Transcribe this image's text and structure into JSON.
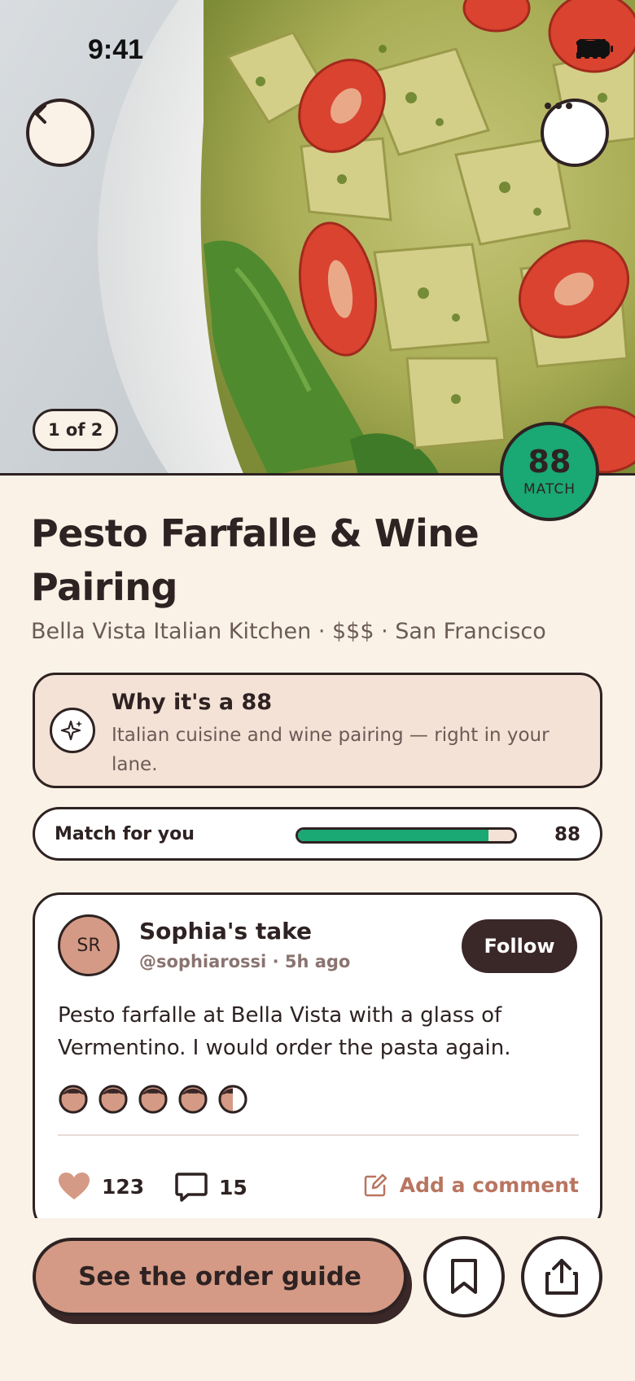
{
  "status_bar": {
    "time": "9:41"
  },
  "hero": {
    "photo_counter": "1 of 2",
    "match_score": "88",
    "match_label": "MATCH"
  },
  "dish": {
    "title": "Pesto Farfalle & Wine Pairing",
    "subtitle": "Bella Vista Italian Kitchen · $$$ · San Francisco"
  },
  "why": {
    "title": "Why it's a 88",
    "text": "Italian cuisine and wine pairing — right in your lane."
  },
  "match_row": {
    "label": "Match for you",
    "value": "88",
    "fraction": 0.88
  },
  "review": {
    "avatar_initials": "SR",
    "name": "Sophia's take",
    "meta": "@sophiarossi · 5h ago",
    "follow_label": "Follow",
    "text": "Pesto farfalle at Bella Vista with a glass of Vermentino. I would order the pasta again.",
    "rating": 4.5,
    "rating_max": 5,
    "likes": "123",
    "comments": "15",
    "add_comment_label": "Add a comment"
  },
  "footer": {
    "cta_label": "See the order guide"
  },
  "colors": {
    "background": "#fbf2e7",
    "accent_green": "#1aa874",
    "accent_clay": "#d49a85",
    "ink": "#2e2222"
  }
}
